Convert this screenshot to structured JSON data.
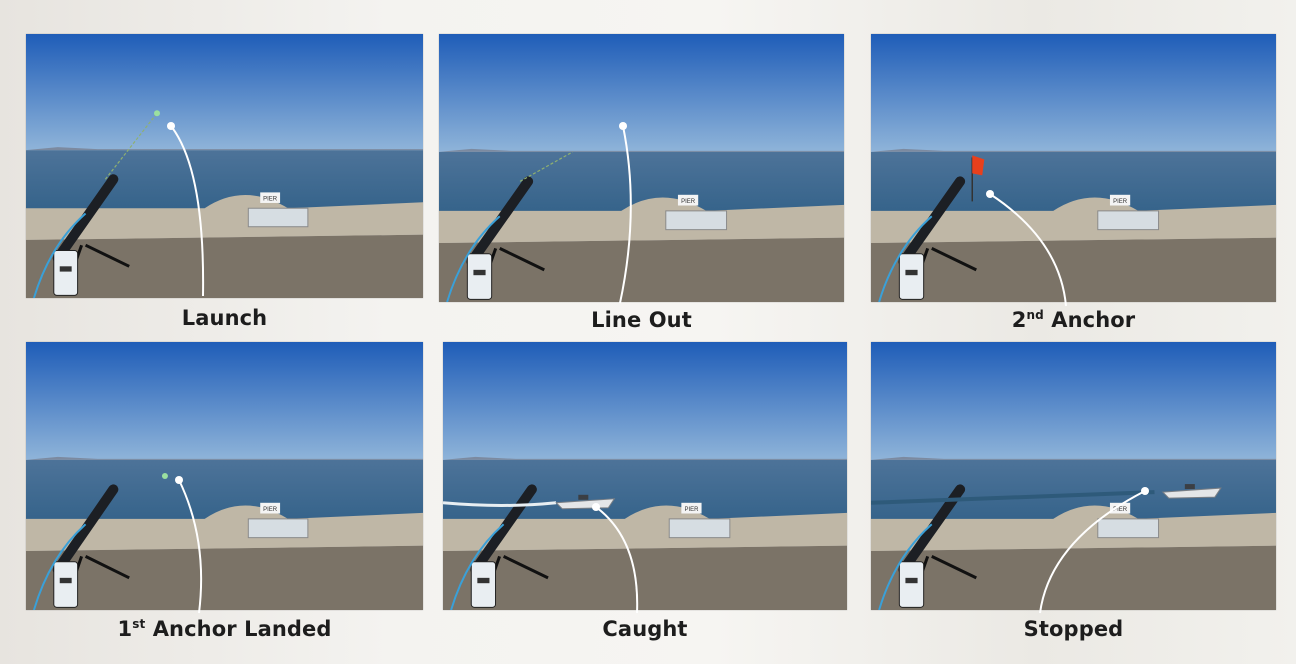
{
  "panels": [
    {
      "id": "launch",
      "caption": {
        "pre": "Launch",
        "sup": "",
        "post": ""
      }
    },
    {
      "id": "line-out",
      "caption": {
        "pre": "Line Out",
        "sup": "",
        "post": ""
      }
    },
    {
      "id": "second-anchor",
      "caption": {
        "pre": "2",
        "sup": "nd",
        "post": " Anchor"
      }
    },
    {
      "id": "first-anchor-landed",
      "caption": {
        "pre": "1",
        "sup": "st",
        "post": " Anchor Landed"
      }
    },
    {
      "id": "caught",
      "caption": {
        "pre": "Caught",
        "sup": "",
        "post": ""
      }
    },
    {
      "id": "stopped",
      "caption": {
        "pre": "Stopped",
        "sup": "",
        "post": ""
      }
    }
  ],
  "sign_text": "PIER",
  "colors": {
    "sky_top": "#1f5db8",
    "sky_bottom": "#8fb4d9",
    "water": "#35638a",
    "wall": "#bfb7a6",
    "ground": "#7b7367",
    "flag": "#e8401c",
    "callout": "#ffffff",
    "caption": "#1d1d1d"
  }
}
